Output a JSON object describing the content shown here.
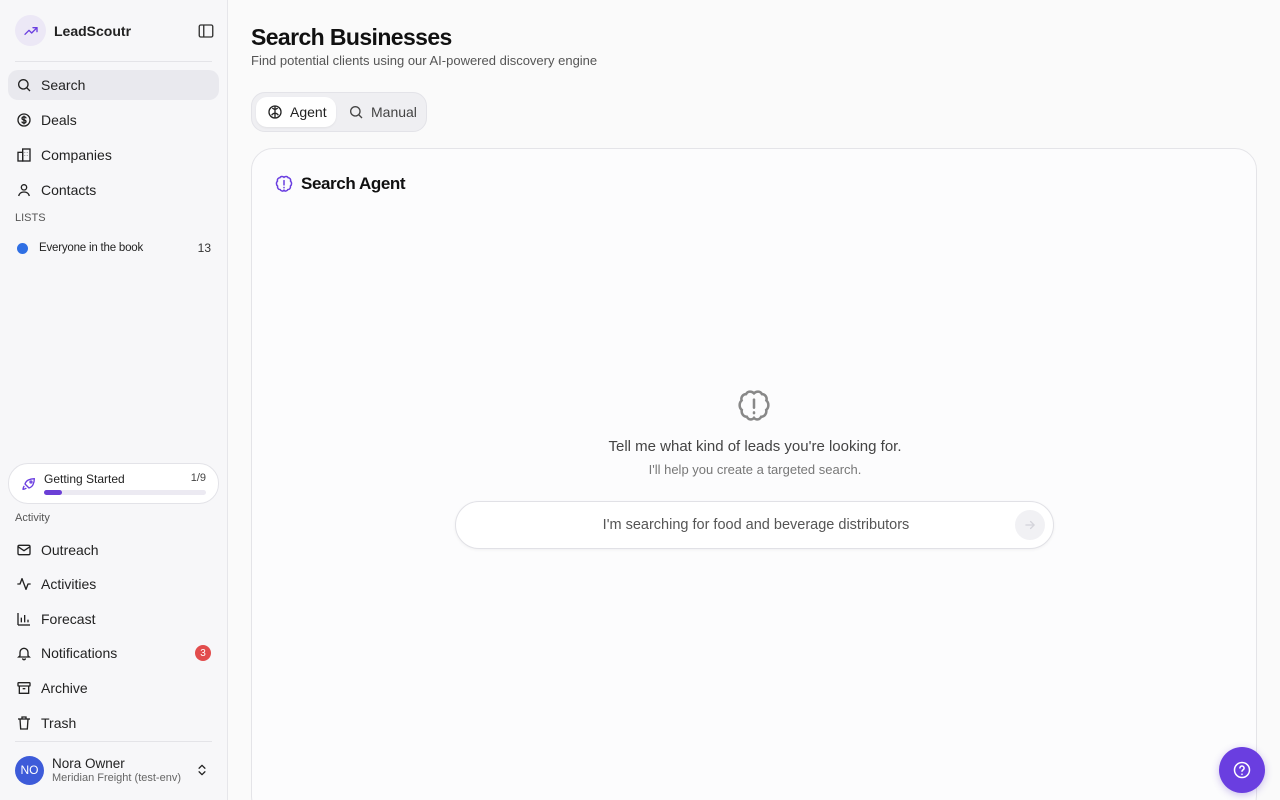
{
  "app": {
    "name": "LeadScoutr"
  },
  "sidebar": {
    "nav": [
      {
        "label": "Search",
        "icon": "search-icon",
        "active": true
      },
      {
        "label": "Deals",
        "icon": "dollar-icon"
      },
      {
        "label": "Companies",
        "icon": "building-icon"
      },
      {
        "label": "Contacts",
        "icon": "user-icon"
      }
    ],
    "lists_label": "LISTS",
    "lists": [
      {
        "label": "Everyone in the book",
        "count": "13",
        "color": "#2f6fe4"
      }
    ],
    "getting_started": {
      "title": "Getting Started",
      "progress_text": "1/9",
      "progress_fraction": 0.11
    },
    "activity_label": "Activity",
    "activity": [
      {
        "label": "Outreach",
        "icon": "mail-icon"
      },
      {
        "label": "Activities",
        "icon": "activity-icon"
      },
      {
        "label": "Forecast",
        "icon": "chart-icon"
      },
      {
        "label": "Notifications",
        "icon": "bell-icon",
        "badge": "3"
      },
      {
        "label": "Archive",
        "icon": "archive-icon"
      },
      {
        "label": "Trash",
        "icon": "trash-icon"
      }
    ],
    "user": {
      "initials": "NO",
      "name": "Nora Owner",
      "org": "Meridian Freight (test-env)"
    }
  },
  "main": {
    "title": "Search Businesses",
    "subtitle": "Find potential clients using our AI-powered discovery engine",
    "modes": [
      {
        "label": "Agent",
        "icon": "brain-icon",
        "active": true
      },
      {
        "label": "Manual",
        "icon": "search-icon"
      }
    ],
    "card": {
      "title": "Search Agent",
      "empty_title": "Tell me what kind of leads you're looking for.",
      "empty_subtitle": "I'll help you create a targeted search.",
      "input_placeholder": "I'm searching for food and beverage distributors"
    }
  },
  "colors": {
    "accent": "#6a3ee0",
    "list_dot": "#2f6fe4",
    "badge": "#e24d4d",
    "avatar": "#3d5bd9"
  }
}
